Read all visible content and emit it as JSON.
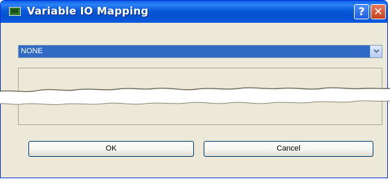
{
  "window": {
    "title": "Variable IO Mapping",
    "help_label": "?",
    "close_label": "✕"
  },
  "mapping_select": {
    "value": "NONE"
  },
  "buttons": {
    "ok_label": "OK",
    "cancel_label": "Cancel"
  },
  "colors": {
    "titlebar": "#0451d0",
    "dialog_background": "#ece9d8",
    "selected_highlight": "#316ac5",
    "close_button": "#c6411c"
  },
  "icons": [
    "app-icon",
    "help-icon",
    "close-icon",
    "chevron-down-icon"
  ]
}
